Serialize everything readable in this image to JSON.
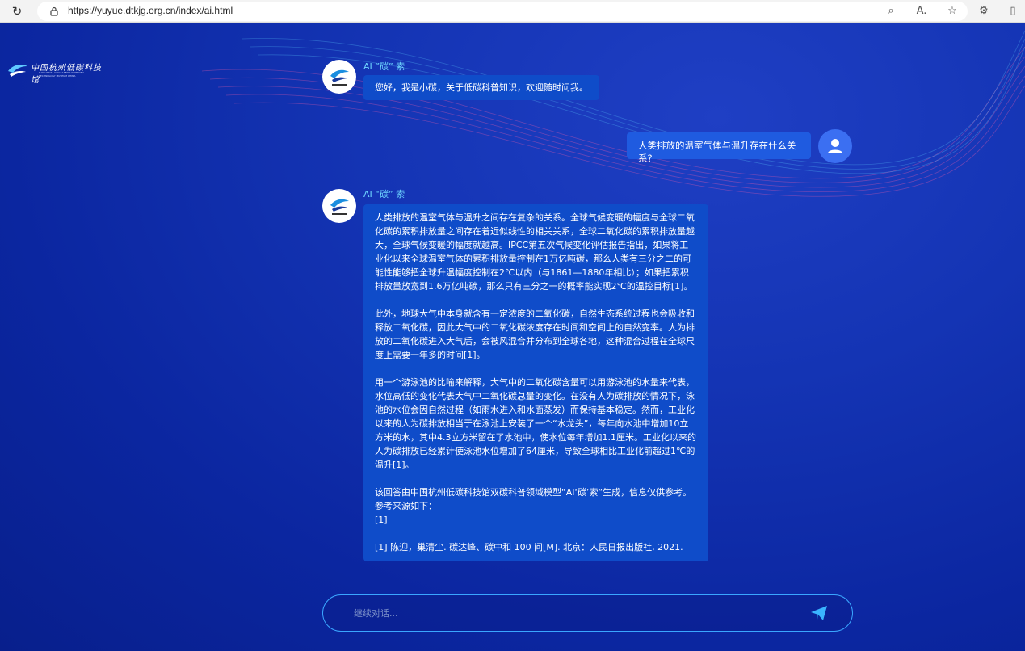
{
  "browser": {
    "url": "https://yuyue.dtkjg.org.cn/index/ai.html"
  },
  "logo": {
    "text": "中国杭州低碳科技馆",
    "sub": "HANGZHOU LOW CARBON SCIENCE & TECHNOLOGY MUSEUM CHINA"
  },
  "messages": [
    {
      "role": "ai",
      "name": "AI “碳” 索",
      "text": "您好，我是小碳，关于低碳科普知识，欢迎随时问我。"
    },
    {
      "role": "user",
      "text": "人类排放的温室气体与温升存在什么关系?"
    },
    {
      "role": "ai",
      "name": "AI “碳” 索",
      "paragraphs": [
        "人类排放的温室气体与温升之间存在复杂的关系。全球气候变暖的幅度与全球二氧化碳的累积排放量之间存在着近似线性的相关关系，全球二氧化碳的累积排放量越大，全球气候变暖的幅度就越高。IPCC第五次气候变化评估报告指出，如果将工业化以来全球温室气体的累积排放量控制在1万亿吨碳，那么人类有三分之二的可能性能够把全球升温幅度控制在2℃以内（与1861—1880年相比）；如果把累积排放量放宽到1.6万亿吨碳，那么只有三分之一的概率能实现2℃的温控目标[1]。",
        "此外，地球大气中本身就含有一定浓度的二氧化碳，自然生态系统过程也会吸收和释放二氧化碳，因此大气中的二氧化碳浓度存在时间和空间上的自然变率。人为排放的二氧化碳进入大气后，会被风混合并分布到全球各地，这种混合过程在全球尺度上需要一年多的时间[1]。",
        "用一个游泳池的比喻来解释，大气中的二氧化碳含量可以用游泳池的水量来代表，水位高低的变化代表大气中二氧化碳总量的变化。在没有人为碳排放的情况下，泳池的水位会因自然过程（如雨水进入和水面蒸发）而保持基本稳定。然而，工业化以来的人为碳排放相当于在泳池上安装了一个“水龙头”，每年向水池中增加10立方米的水，其中4.3立方米留在了水池中，使水位每年增加1.1厘米。工业化以来的人为碳排放已经累计使泳池水位增加了64厘米，导致全球相比工业化前超过1℃的温升[1]。",
        "该回答由中国杭州低碳科技馆双碳科普领域模型“AI‘碳’索”生成，信息仅供参考。参考来源如下：\n[1]",
        "[1] 陈迎，巢清尘. 碳达峰、碳中和 100 问[M]. 北京：人民日报出版社, 2021."
      ]
    }
  ],
  "input": {
    "placeholder": "继续对话..."
  },
  "colors": {
    "accent": "#3aa6ff",
    "bubble": "#0f4cc9",
    "name": "#6fd6ff"
  }
}
